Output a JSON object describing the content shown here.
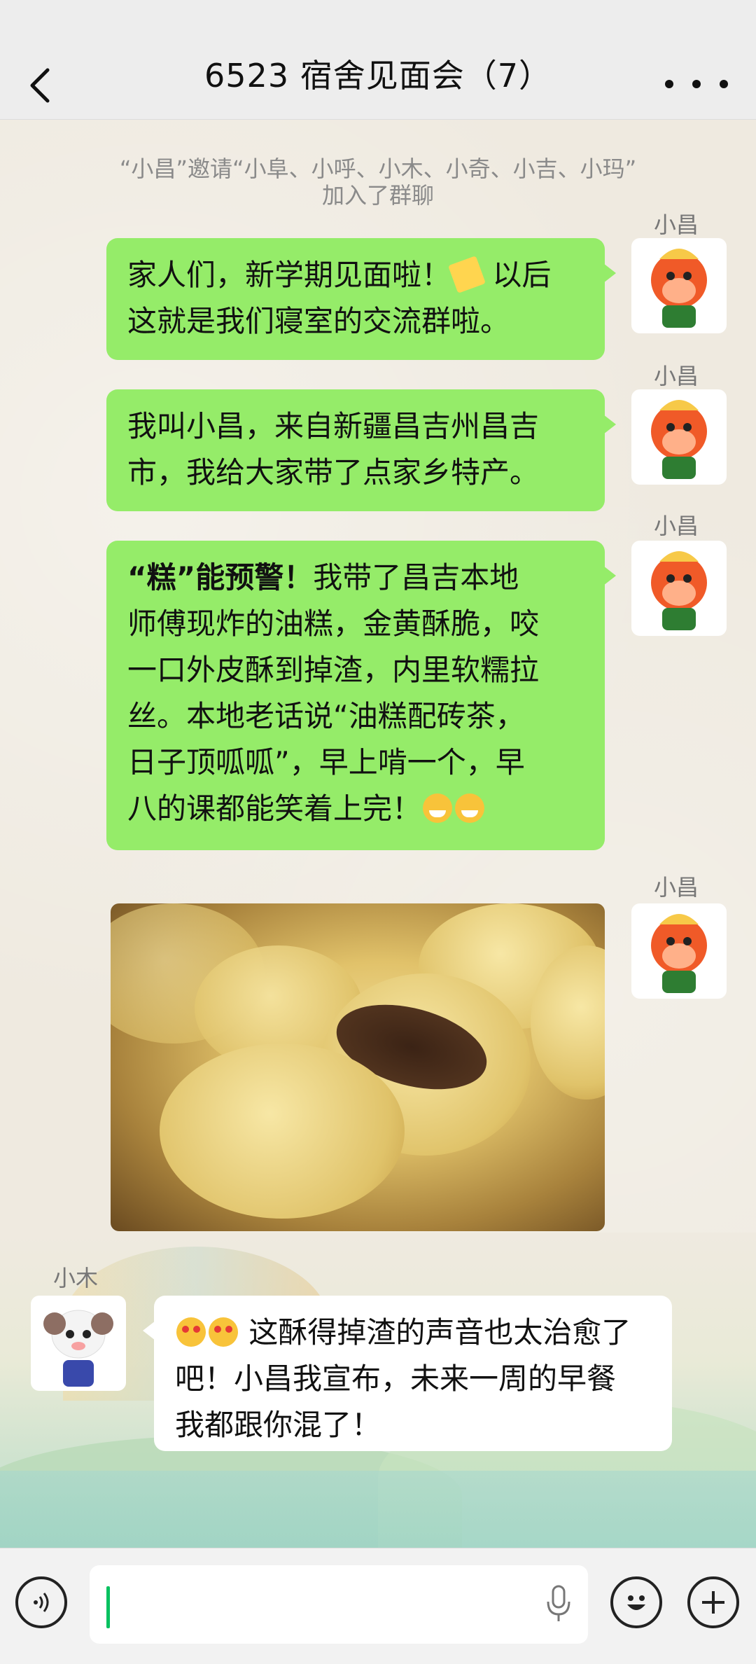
{
  "header": {
    "title": "6523 宿舍见面会（7）",
    "back_icon": "chevron-left-icon",
    "more_icon": "more-dots-icon"
  },
  "system_message": {
    "line1": "“小昌”邀请“小阜、小呼、小木、小奇、小吉、小玛”",
    "line2": "加入了群聊"
  },
  "messages": [
    {
      "sender": "小昌",
      "side": "right",
      "line1": "家人们，新学期见面啦！",
      "line1_after": " 以后",
      "line2": "这就是我们寝室的交流群啦。"
    },
    {
      "sender": "小昌",
      "side": "right",
      "line1": "我叫小昌，来自新疆昌吉州昌吉",
      "line2": "市，我给大家带了点家乡特产。"
    },
    {
      "sender": "小昌",
      "side": "right",
      "bold": "“糕”能预警！",
      "line1_rest": "我带了昌吉本地",
      "line2": "师傅现炸的油糕，金黄酥脆，咬",
      "line3": "一口外皮酥到掉渣，内里软糯拉",
      "line4": "丝。本地老话说“油糕配砖茶，",
      "line5": "日子顶呱呱”，早上啃一个，早",
      "line6": "八的课都能笑着上完！"
    },
    {
      "sender": "小昌",
      "side": "right",
      "type": "image",
      "image_desc": "fried-oil-cake-photo"
    },
    {
      "sender": "小木",
      "side": "left",
      "line1": " 这酥得掉渣的声音也太治愈了",
      "line2": "吧！小昌我宣布，未来一周的早餐",
      "line3": "我都跟你混了！"
    }
  ],
  "input_bar": {
    "voice_icon": "voice-icon",
    "mic_icon": "mic-icon",
    "emoji_icon": "emoji-icon",
    "plus_icon": "plus-icon",
    "input_value": ""
  },
  "colors": {
    "bubble_green": "#95ec69",
    "bubble_white": "#ffffff",
    "header_bg": "#ededed",
    "caret": "#07c160"
  }
}
